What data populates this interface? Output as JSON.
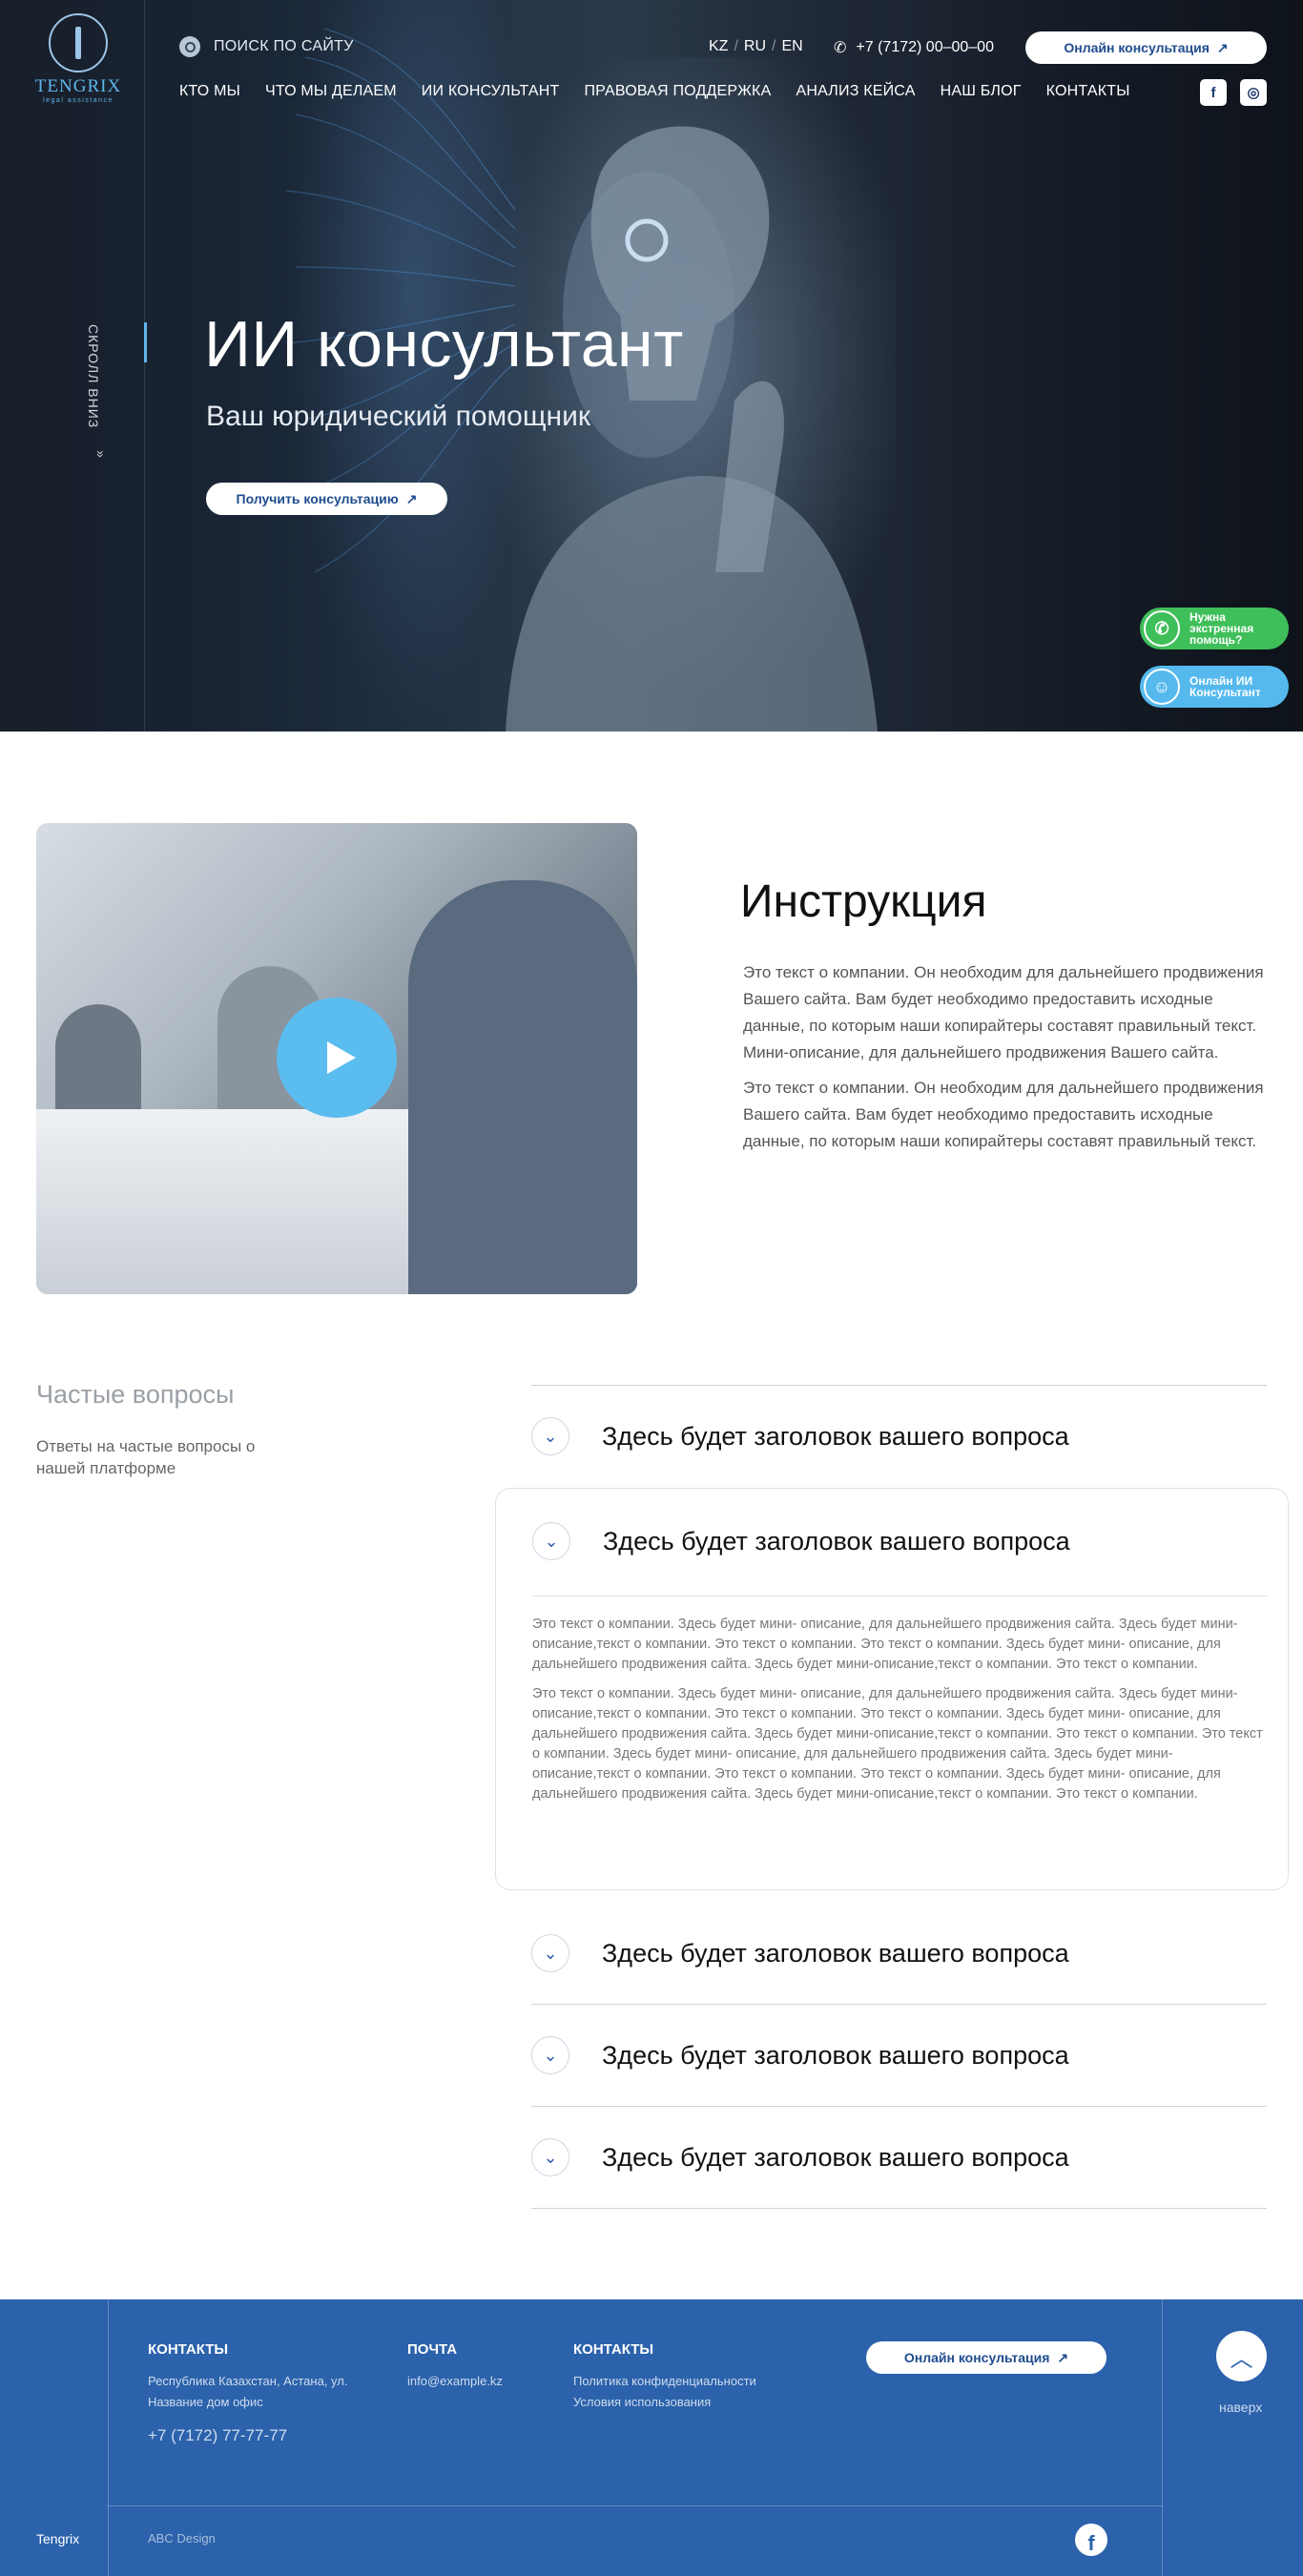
{
  "header": {
    "brand_name": "TENGRIX",
    "brand_tag": "legal assistance",
    "search_label": "ПОИСК ПО САЙТУ",
    "languages": [
      "KZ",
      "RU",
      "EN"
    ],
    "lang_sep": "/",
    "phone": "+7 (7172) 00–00–00",
    "consult_button": "Онлайн консультация",
    "arrow": "↗",
    "nav": [
      "КТО МЫ",
      "ЧТО МЫ ДЕЛАЕМ",
      "ИИ КОНСУЛЬТАНТ",
      "ПРАВОВАЯ ПОДДЕРЖКА",
      "АНАЛИЗ КЕЙСА",
      "НАШ БЛОГ",
      "КОНТАКТЫ"
    ],
    "social": {
      "facebook": "f",
      "instagram": "◎"
    }
  },
  "hero": {
    "scroll_label": "СКРОЛЛ ВНИЗ",
    "scroll_arrow": "»",
    "title": "ИИ консультант",
    "subtitle": "Ваш юридический помощник",
    "button": "Получить консультацию"
  },
  "floating": {
    "help": "Нужна экстренная помощь?",
    "help_icon": "✆",
    "ai": "Онлайн ИИ Консультант",
    "ai_icon": "☺"
  },
  "instruction": {
    "title": "Инструкция",
    "paragraphs": [
      "Это текст о компании. Он необходим для дальнейшего продвижения Вашего сайта. Вам будет необходимо предоставить исходные данные, по которым наши копирайтеры составят правильный текст. Мини-описание, для дальнейшего продвижения Вашего сайта.",
      "Это текст о компании. Он необходим для дальнейшего продвижения Вашего сайта. Вам будет необходимо предоставить исходные данные, по которым наши копирайтеры составят правильный текст."
    ]
  },
  "faq": {
    "title": "Частые вопросы",
    "subtitle": "Ответы на частые вопросы о нашей платформе",
    "chevron": "⌄",
    "items": [
      "Здесь будет заголовок вашего вопроса",
      "Здесь будет заголовок вашего вопроса",
      "Здесь будет заголовок вашего вопроса",
      "Здесь будет заголовок вашего вопроса",
      "Здесь будет заголовок вашего вопроса"
    ],
    "open_answer": [
      "Это текст о компании. Здесь будет мини- описание, для дальнейшего продвижения сайта. Здесь будет мини-описание,текст о компании.  Это текст о компании.  Это текст о компании. Здесь будет мини- описание, для дальнейшего продвижения сайта. Здесь будет мини-описание,текст о компании.  Это текст о компании.",
      "Это текст о компании. Здесь будет мини- описание, для дальнейшего продвижения сайта. Здесь будет мини-описание,текст о компании.  Это текст о компании.  Это текст о компании. Здесь будет мини- описание, для дальнейшего продвижения сайта. Здесь будет мини-описание,текст о компании.  Это текст о компании.  Это текст о компании. Здесь будет мини- описание, для дальнейшего продвижения сайта. Здесь будет мини-описание,текст о компании.  Это текст о компании.  Это текст о компании. Здесь будет мини- описание, для дальнейшего продвижения сайта. Здесь будет мини-описание,текст о компании.  Это текст о компании."
    ]
  },
  "footer": {
    "contacts_title": "КОНТАКТЫ",
    "address": "Республика Казахстан, Астана, ул. Название дом офис",
    "phone": "+7 (7172) 77-77-77",
    "mail_title": "ПОЧТА",
    "email": "info@example.kz",
    "links_title": "КОНТАКТЫ",
    "links": [
      "Политика конфиденциальности",
      "Условия использования"
    ],
    "consult_button": "Онлайн консультация",
    "to_top_label": "наверх",
    "to_top_icon": "︿",
    "brand": "Tengrix",
    "design": "ABC Design",
    "facebook_icon": "f"
  },
  "colors": {
    "accent_blue": "#5bbcf0",
    "brand_blue": "#2b62ab",
    "whatsapp_green": "#3fbf5a"
  }
}
